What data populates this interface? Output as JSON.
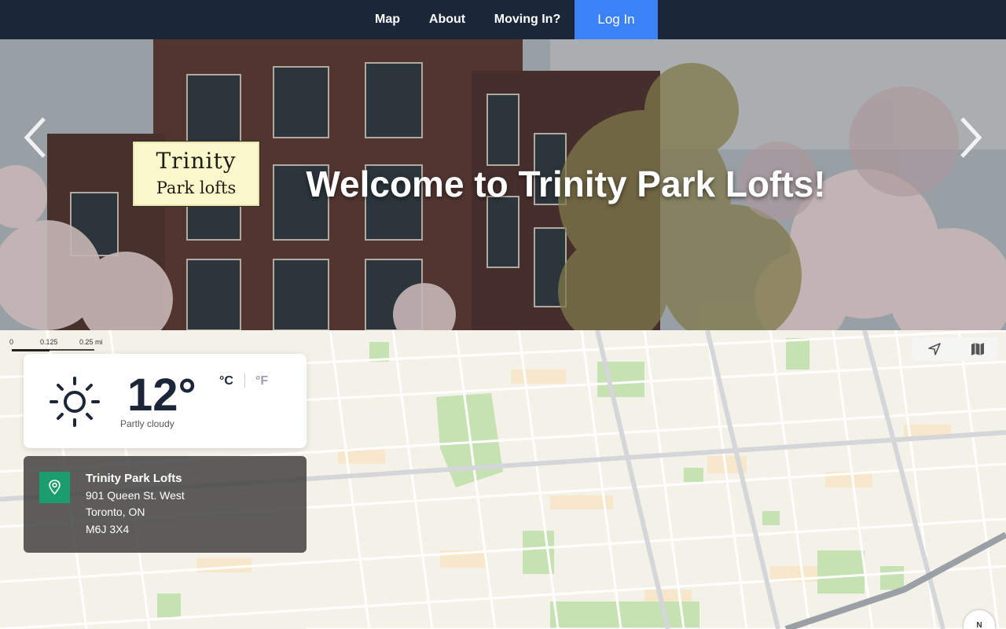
{
  "nav": {
    "items": [
      "Map",
      "About",
      "Moving In?"
    ],
    "login_label": "Log In",
    "background": "#1c2639",
    "login_color": "#3b82f6"
  },
  "hero": {
    "title": "Welcome to Trinity Park Lofts!",
    "logo_line1": "Trinity",
    "logo_line2": "Park lofts"
  },
  "map": {
    "scale_labels": [
      "0",
      "0.125",
      "0.25 mi"
    ],
    "compass_label": "N"
  },
  "weather": {
    "temperature": "12°",
    "condition": "Partly cloudy",
    "unit_celsius": "°C",
    "unit_fahrenheit": "°F",
    "icon": "sun-icon"
  },
  "address": {
    "name": "Trinity Park Lofts",
    "street": "901 Queen St. West",
    "city": "Toronto, ON",
    "postal": "M6J 3X4",
    "icon": "location-pin-icon",
    "accent": "#1a9e6e"
  }
}
